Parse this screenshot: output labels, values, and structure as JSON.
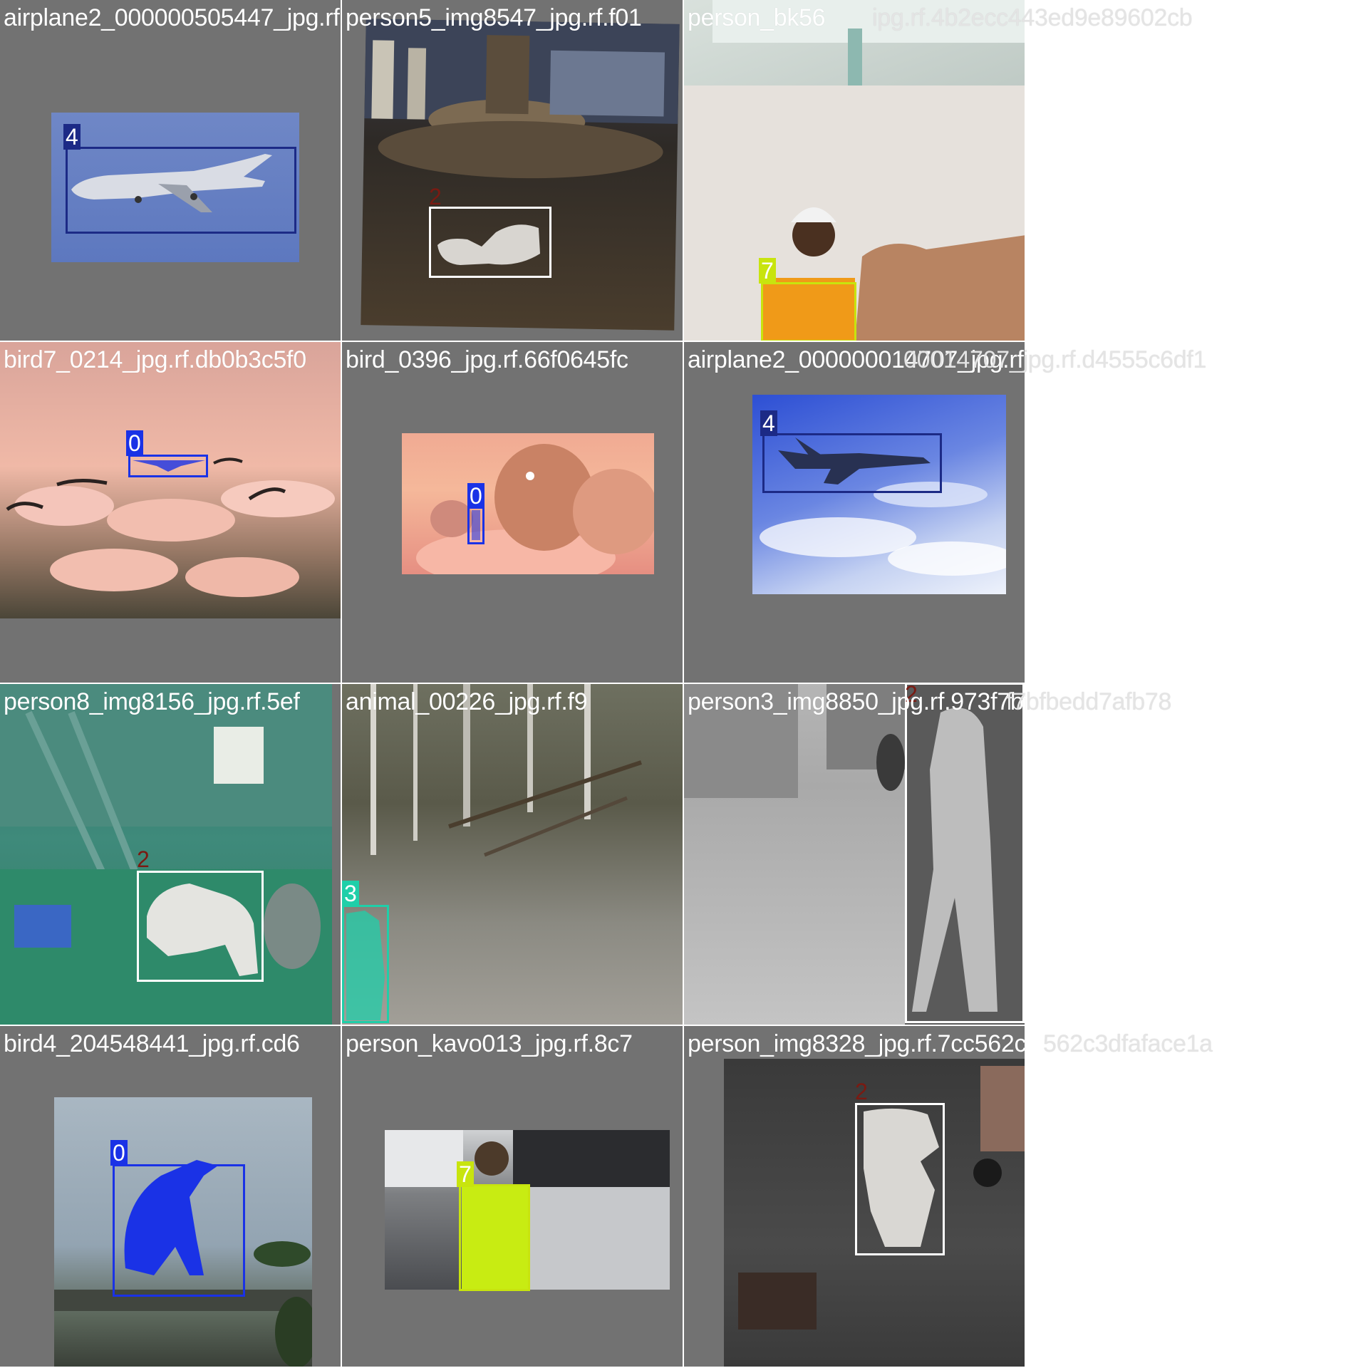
{
  "tiles": [
    {
      "filename": "airplane2_000000505447_jpg.rf.",
      "label": "4"
    },
    {
      "filename": "person5_img8547_jpg.rf.f01",
      "label": "2"
    },
    {
      "filename": "person_bk56",
      "label": "7"
    },
    {
      "filename": "bird7_0214_jpg.rf.db0b3c5f0",
      "label": "0"
    },
    {
      "filename": "bird_0396_jpg.rf.66f0645fc",
      "label": "0"
    },
    {
      "filename": "airplane2_000000014707_jpg.rf.d4555c6df1",
      "label": "4"
    },
    {
      "filename": "person8_img8156_jpg.rf.5ef",
      "label": "2"
    },
    {
      "filename": "animal_00226_jpg.rf.f9",
      "label": "3"
    },
    {
      "filename": "person3_img8850_jpg.rf.973f7bfbedd7afb78",
      "label": "2"
    },
    {
      "filename": "bird4_204548441_jpg.rf.cd6",
      "label": "0"
    },
    {
      "filename": "person_kavo013_jpg.rf.8c7",
      "label": "7"
    },
    {
      "filename": "person_img8328_jpg.rf.7cc562c3dfaface1a",
      "label": "2"
    }
  ],
  "spill_text": {
    "row1": "ipg.rf.4b2ecc443ed9e89602cb",
    "row2": "00014707_jpg.rf.d4555c6df1",
    "row3": "f7bfbedd7afb78",
    "row4": "562c3dfaface1a"
  },
  "colors": {
    "class_0": "#1a32e6",
    "class_2": "#ffffff",
    "class_2_label": "#7a1a12",
    "class_3": "#1fcfa9",
    "class_4": "#1c2a86",
    "class_7": "#c8e40e",
    "tile_bg": "#727272"
  }
}
